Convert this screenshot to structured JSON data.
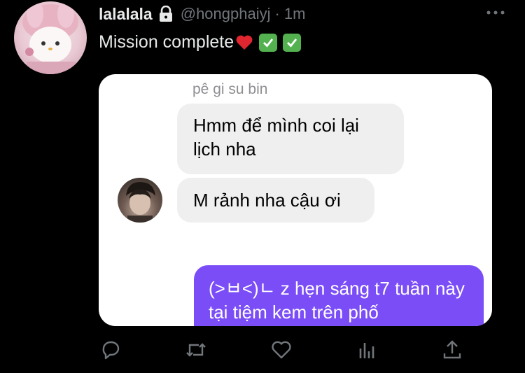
{
  "tweet": {
    "display_name": "lalalala",
    "handle": "@hongphaiyj",
    "separator": "·",
    "time": "1m",
    "text": "Mission complete"
  },
  "chat": {
    "sender_name": "pê gi su bin",
    "incoming": [
      "Hmm để mình coi lại lịch nha",
      "M rảnh nha cậu ơi"
    ],
    "outgoing": "(>ㅂ<)ㄴ z hẹn sáng t7 tuần này tại tiệm kem trên phố"
  },
  "colors": {
    "background": "#000000",
    "muted": "#71767b",
    "outgoing_bubble": "#7b4df7",
    "incoming_bubble": "#efefef",
    "check": "#53b14f",
    "heart": "#e0262e"
  },
  "icons": [
    "lock-icon",
    "more-icon",
    "heart-emoji-icon",
    "check-emoji-icon",
    "reply-icon",
    "retweet-icon",
    "like-icon",
    "views-icon",
    "share-icon"
  ]
}
